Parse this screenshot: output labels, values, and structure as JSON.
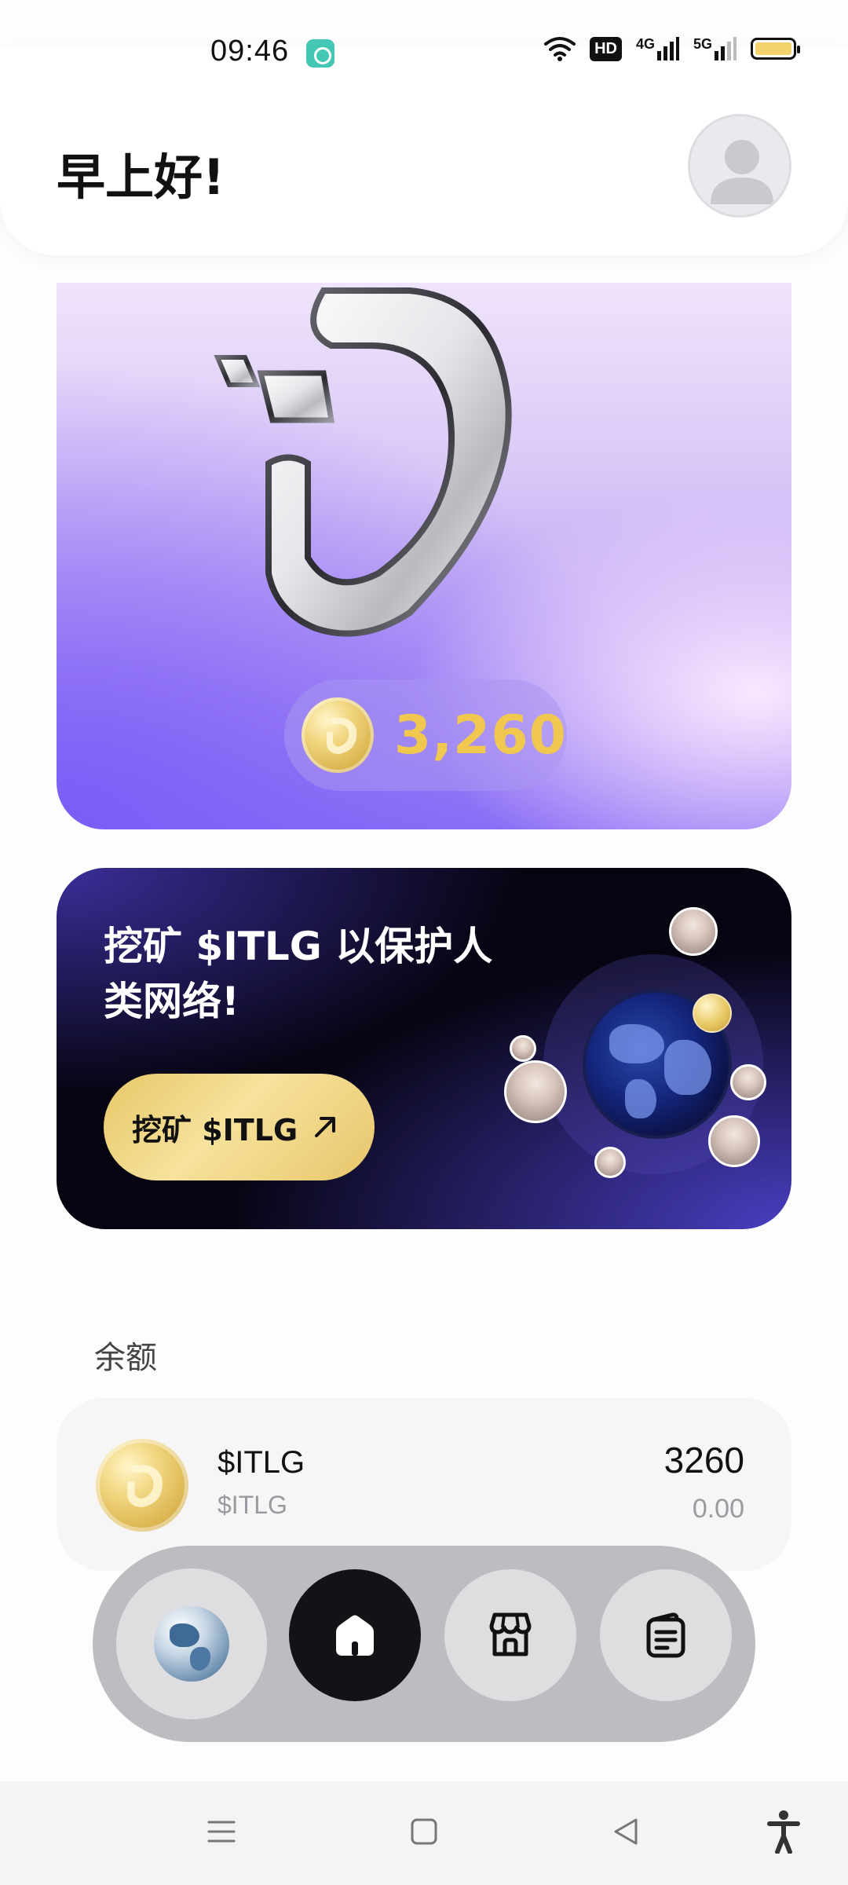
{
  "status_bar": {
    "time": "09:46",
    "hd_label": "HD",
    "net1_label": "4G",
    "net2_label": "5G"
  },
  "header": {
    "greeting": "早上好!"
  },
  "hero": {
    "coin_amount": "3,260"
  },
  "mining_banner": {
    "title": "挖矿 $ITLG 以保护人类网络!",
    "button_label": "挖矿 $ITLG"
  },
  "balance": {
    "section_label": "余额",
    "token_name": "$ITLG",
    "token_symbol": "$ITLG",
    "amount": "3260",
    "value": "0.00"
  },
  "nav": {
    "items": [
      {
        "icon": "globe-icon",
        "active": false
      },
      {
        "icon": "home-icon",
        "active": true
      },
      {
        "icon": "store-icon",
        "active": false
      },
      {
        "icon": "docs-icon",
        "active": false
      }
    ]
  },
  "system_nav": {
    "icons": [
      "menu-icon",
      "square-icon",
      "back-icon",
      "accessibility-icon"
    ]
  },
  "colors": {
    "gold": "#f1c84f",
    "hero_purple": "#8f74f5",
    "banner_dark": "#050410",
    "nav_active": "#121316"
  }
}
